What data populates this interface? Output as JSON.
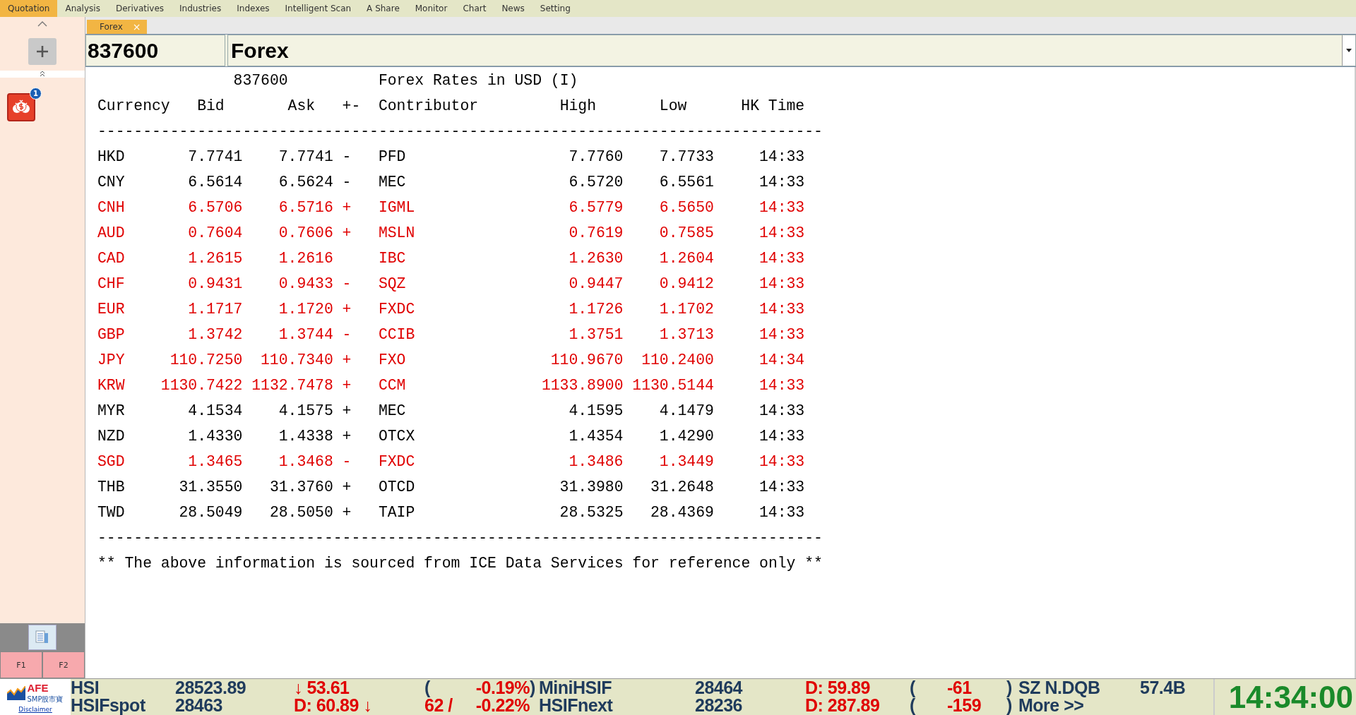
{
  "menu": [
    {
      "label": "Quotation",
      "selected": true
    },
    {
      "label": "Analysis",
      "selected": false
    },
    {
      "label": "Derivatives",
      "selected": false
    },
    {
      "label": "Industries",
      "selected": false
    },
    {
      "label": "Indexes",
      "selected": false
    },
    {
      "label": "Intelligent Scan",
      "selected": false
    },
    {
      "label": "A Share",
      "selected": false
    },
    {
      "label": "Monitor",
      "selected": false
    },
    {
      "label": "Chart",
      "selected": false
    },
    {
      "label": "News",
      "selected": false
    },
    {
      "label": "Setting",
      "selected": false
    }
  ],
  "sidebar": {
    "badge": "1",
    "function_keys": [
      "F1",
      "F2"
    ]
  },
  "tabs": [
    {
      "label": "Forex",
      "selected": true,
      "close": "×"
    }
  ],
  "code_field": {
    "value": "837600"
  },
  "name_field": {
    "value": "Forex"
  },
  "report": {
    "code": "837600",
    "title": "Forex Rates in USD (I)",
    "columns": [
      "Currency",
      "Bid",
      "Ask",
      "+-",
      "Contributor",
      "High",
      "Low",
      "HK Time"
    ],
    "separator": "--------------------------------------------------------------------------------",
    "rows": [
      {
        "currency": "HKD",
        "bid": "7.7741",
        "ask": "7.7741",
        "change": "-",
        "contributor": "PFD",
        "high": "7.7760",
        "low": "7.7733",
        "time": "14:33",
        "color": "#000000"
      },
      {
        "currency": "CNY",
        "bid": "6.5614",
        "ask": "6.5624",
        "change": "-",
        "contributor": "MEC",
        "high": "6.5720",
        "low": "6.5561",
        "time": "14:33",
        "color": "#000000"
      },
      {
        "currency": "CNH",
        "bid": "6.5706",
        "ask": "6.5716",
        "change": "+",
        "contributor": "IGML",
        "high": "6.5779",
        "low": "6.5650",
        "time": "14:33",
        "color": "#e00000"
      },
      {
        "currency": "AUD",
        "bid": "0.7604",
        "ask": "0.7606",
        "change": "+",
        "contributor": "MSLN",
        "high": "0.7619",
        "low": "0.7585",
        "time": "14:33",
        "color": "#e00000"
      },
      {
        "currency": "CAD",
        "bid": "1.2615",
        "ask": "1.2616",
        "contributor": "IBC",
        "high": "1.2630",
        "low": "1.2604",
        "time": "14:33",
        "color": "#e00000"
      },
      {
        "currency": "CHF",
        "bid": "0.9431",
        "ask": "0.9433",
        "change": "-",
        "contributor": "SQZ",
        "high": "0.9447",
        "low": "0.9412",
        "time": "14:33",
        "color": "#e00000"
      },
      {
        "currency": "EUR",
        "bid": "1.1717",
        "ask": "1.1720",
        "change": "+",
        "contributor": "FXDC",
        "high": "1.1726",
        "low": "1.1702",
        "time": "14:33",
        "color": "#e00000"
      },
      {
        "currency": "GBP",
        "bid": "1.3742",
        "ask": "1.3744",
        "change": "-",
        "contributor": "CCIB",
        "high": "1.3751",
        "low": "1.3713",
        "time": "14:33",
        "color": "#e00000"
      },
      {
        "currency": "JPY",
        "bid": "110.7250",
        "ask": "110.7340",
        "change": "+",
        "contributor": "FXO",
        "high": "110.9670",
        "low": "110.2400",
        "time": "14:34",
        "color": "#e00000"
      },
      {
        "currency": "KRW",
        "bid": "1130.7422",
        "ask": "1132.7478",
        "change": "+",
        "contributor": "CCM",
        "high": "1133.8900",
        "low": "1130.5144",
        "time": "14:33",
        "color": "#e00000"
      },
      {
        "currency": "MYR",
        "bid": "4.1534",
        "ask": "4.1575",
        "change": "+",
        "contributor": "MEC",
        "high": "4.1595",
        "low": "4.1479",
        "time": "14:33",
        "color": "#000000"
      },
      {
        "currency": "NZD",
        "bid": "1.4330",
        "ask": "1.4338",
        "change": "+",
        "contributor": "OTCX",
        "high": "1.4354",
        "low": "1.4290",
        "time": "14:33",
        "color": "#000000"
      },
      {
        "currency": "SGD",
        "bid": "1.3465",
        "ask": "1.3468",
        "change": "-",
        "contributor": "FXDC",
        "high": "1.3486",
        "low": "1.3449",
        "time": "14:33",
        "color": "#e00000"
      },
      {
        "currency": "THB",
        "bid": "31.3550",
        "ask": "31.3760",
        "change": "+",
        "contributor": "OTCD",
        "high": "31.3980",
        "low": "31.2648",
        "time": "14:33",
        "color": "#000000"
      },
      {
        "currency": "TWD",
        "bid": "28.5049",
        "ask": "28.5050",
        "change": "+",
        "contributor": "TAIP",
        "high": "28.5325",
        "low": "28.4369",
        "time": "14:33",
        "color": "#000000"
      }
    ],
    "note": "** The above information is sourced from ICE Data Services for reference only **"
  },
  "ticker": {
    "logo": "AFE",
    "logo_sub": "SMP股市寶",
    "disclaimer": "Disclaimer",
    "clock": "14:34:00",
    "rows": [
      [
        {
          "text": "HSI",
          "negative": false
        },
        {
          "text": "28523.89",
          "negative": false
        },
        {
          "text": "↓ 53.61",
          "negative": true
        },
        {
          "text": "(",
          "negative": false
        },
        {
          "text": "-0.19%",
          "negative": true
        },
        {
          "text": ")",
          "negative": false
        },
        {
          "text": "MiniHSIF",
          "negative": false
        },
        {
          "text": "28464",
          "negative": false
        },
        {
          "text": "D: 59.89",
          "negative": true
        },
        {
          "text": "(",
          "negative": false
        },
        {
          "text": "-61",
          "negative": true
        },
        {
          "text": ")",
          "negative": false
        },
        {
          "text": "SZ N.DQB",
          "negative": false
        },
        {
          "text": "57.4B",
          "negative": false
        }
      ],
      [
        {
          "text": "HSIFspot",
          "negative": false
        },
        {
          "text": "28463",
          "negative": false
        },
        {
          "text": "D: 60.89 ↓",
          "negative": true
        },
        {
          "text": "62 /",
          "negative": true
        },
        {
          "text": "-0.22%",
          "negative": true
        },
        null,
        {
          "text": "HSIFnext",
          "negative": false
        },
        {
          "text": "28236",
          "negative": false
        },
        {
          "text": "D: 287.89",
          "negative": true
        },
        {
          "text": "(",
          "negative": false
        },
        {
          "text": "-159",
          "negative": true
        },
        {
          "text": ")",
          "negative": false
        },
        {
          "text": "More >>",
          "negative": false
        }
      ]
    ]
  }
}
